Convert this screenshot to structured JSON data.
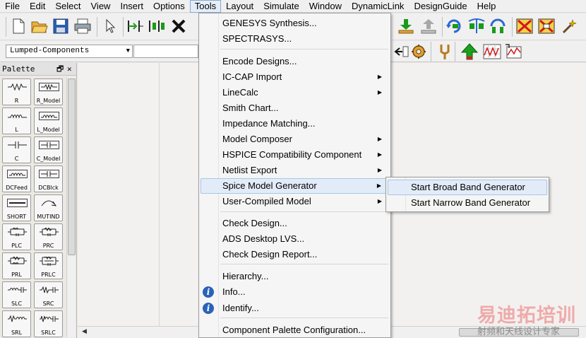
{
  "menubar": {
    "items": [
      "File",
      "Edit",
      "Select",
      "View",
      "Insert",
      "Options",
      "Tools",
      "Layout",
      "Simulate",
      "Window",
      "DynamicLink",
      "DesignGuide",
      "Help"
    ],
    "active": "Tools"
  },
  "toolbar": {
    "library_select": "Lumped-Components",
    "row1_icons": [
      "new-file-icon",
      "open-folder-icon",
      "save-icon",
      "print-icon",
      "select-arrow-icon",
      "insert-pin-icon",
      "insert-port-icon",
      "delete-x-icon",
      "import-icon",
      "export-icon",
      "rotate-icon",
      "mirror-icon",
      "align-icon",
      "deactivate-icon",
      "short-icon",
      "wand-icon"
    ],
    "row2_icons": [
      "push-into-icon",
      "gear-icon",
      "tuning-fork-icon",
      "up-arrow-icon",
      "display-graph-icon",
      "simulate-graph-icon"
    ]
  },
  "palette": {
    "title": "Palette",
    "items": [
      {
        "label": "R",
        "icon": "resistor-icon"
      },
      {
        "label": "R_Model",
        "icon": "resistor-model-icon"
      },
      {
        "label": "L",
        "icon": "inductor-icon"
      },
      {
        "label": "L_Model",
        "icon": "inductor-model-icon"
      },
      {
        "label": "C",
        "icon": "capacitor-icon"
      },
      {
        "label": "C_Model",
        "icon": "capacitor-model-icon"
      },
      {
        "label": "DCFeed",
        "icon": "dcfeed-icon"
      },
      {
        "label": "DCBlck",
        "icon": "dcblock-icon"
      },
      {
        "label": "SHORT",
        "icon": "short-icon"
      },
      {
        "label": "MUTIND",
        "icon": "mutual-inductor-icon"
      },
      {
        "label": "PLC",
        "icon": "plc-icon"
      },
      {
        "label": "PRC",
        "icon": "prc-icon"
      },
      {
        "label": "PRL",
        "icon": "prl-icon"
      },
      {
        "label": "PRLC",
        "icon": "prlc-icon"
      },
      {
        "label": "SLC",
        "icon": "slc-icon"
      },
      {
        "label": "SRC",
        "icon": "src-icon"
      },
      {
        "label": "SRL",
        "icon": "srl-icon"
      },
      {
        "label": "SRLC",
        "icon": "srlc-icon"
      }
    ]
  },
  "tools_menu": {
    "items": [
      {
        "label": "GENESYS Synthesis...",
        "submenu": false
      },
      {
        "label": "SPECTRASYS...",
        "submenu": false
      },
      {
        "label": "Encode Designs...",
        "submenu": false
      },
      {
        "label": "IC-CAP Import",
        "submenu": true
      },
      {
        "label": "LineCalc",
        "submenu": true
      },
      {
        "label": "Smith Chart...",
        "submenu": false
      },
      {
        "label": "Impedance Matching...",
        "submenu": false
      },
      {
        "label": "Model Composer",
        "submenu": true
      },
      {
        "label": "HSPICE Compatibility Component",
        "submenu": true
      },
      {
        "label": "Netlist Export",
        "submenu": true
      },
      {
        "label": "Spice Model Generator",
        "submenu": true,
        "highlighted": true
      },
      {
        "label": "User-Compiled Model",
        "submenu": true
      },
      {
        "label": "Check Design...",
        "submenu": false
      },
      {
        "label": "ADS Desktop LVS...",
        "submenu": false
      },
      {
        "label": "Check Design Report...",
        "submenu": false
      },
      {
        "label": "Hierarchy...",
        "submenu": false
      },
      {
        "label": "Info...",
        "submenu": false,
        "icon": "info-icon"
      },
      {
        "label": "Identify...",
        "submenu": false,
        "icon": "info-icon"
      },
      {
        "label": "Component Palette Configuration...",
        "submenu": false
      }
    ]
  },
  "spice_submenu": {
    "items": [
      {
        "label": "Start Broad Band Generator",
        "highlighted": true
      },
      {
        "label": "Start Narrow Band Generator",
        "highlighted": false
      }
    ]
  },
  "watermark": {
    "line1": "易迪拓培训",
    "line2": "射频和天线设计专家"
  },
  "colors": {
    "menu_highlight": "#e2ecf8",
    "menu_highlight_border": "#a9c4e6",
    "canvas_bg": "#f2f1f0",
    "info_icon": "#2a62b8"
  }
}
